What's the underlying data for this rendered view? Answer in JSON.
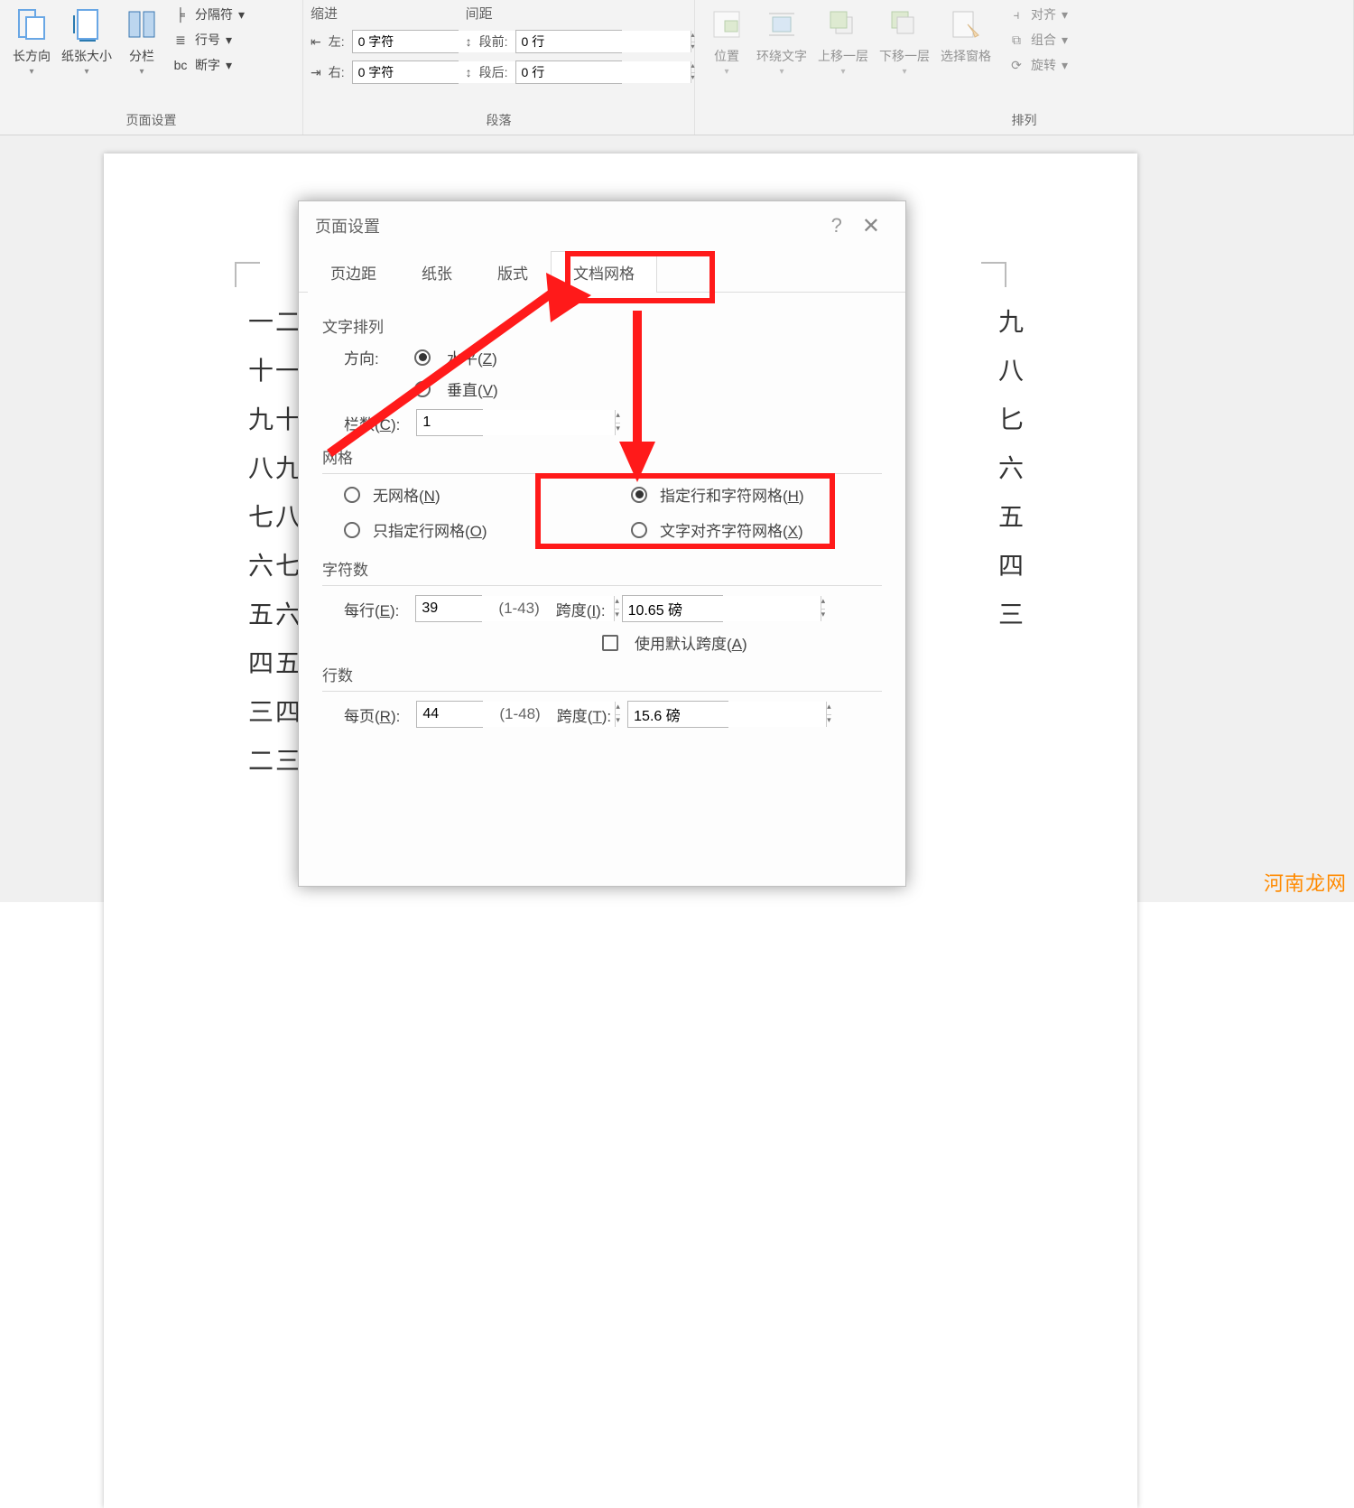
{
  "ribbon": {
    "pageSetup": {
      "label": "页面设置",
      "orientation": "长方向",
      "size": "纸张大小",
      "columns": "分栏",
      "breaks": "分隔符",
      "lineNumbers": "行号",
      "hyphenation": "断字"
    },
    "paragraph": {
      "label": "段落",
      "indentLabel": "缩进",
      "spacingLabel": "间距",
      "leftLabel": "左:",
      "rightLabel": "右:",
      "beforeLabel": "段前:",
      "afterLabel": "段后:",
      "leftVal": "0 字符",
      "rightVal": "0 字符",
      "beforeVal": "0 行",
      "afterVal": "0 行"
    },
    "arrange": {
      "label": "排列",
      "position": "位置",
      "wrap": "环绕文字",
      "forward": "上移一层",
      "backward": "下移一层",
      "selection": "选择窗格",
      "align": "对齐",
      "group": "组合",
      "rotate": "旋转"
    }
  },
  "doc": {
    "leftLines": [
      "一二",
      "十一",
      "九十",
      "八九",
      "七八",
      "六七",
      "五六",
      "四五",
      "三四",
      "二三"
    ],
    "rightLines": [
      "九",
      "八",
      "匕",
      "六",
      "五",
      "四",
      "三"
    ]
  },
  "dialog": {
    "title": "页面设置",
    "tabs": {
      "margins": "页边距",
      "paper": "纸张",
      "layout": "版式",
      "grid": "文档网格"
    },
    "textDirection": {
      "title": "文字排列",
      "dirLabel": "方向:",
      "horiz": "水平(Z)",
      "vert": "垂直(V)",
      "colsLabel": "栏数(C):",
      "colsVal": "1"
    },
    "grid": {
      "title": "网格",
      "none": "无网格(N)",
      "both": "指定行和字符网格(H)",
      "linesOnly": "只指定行网格(O)",
      "snap": "文字对齐字符网格(X)"
    },
    "chars": {
      "title": "字符数",
      "perLine": "每行(E):",
      "perLineVal": "39",
      "perLineRange": "(1-43)",
      "pitch": "跨度(I):",
      "pitchVal": "10.65 磅",
      "default": "使用默认跨度(A)"
    },
    "lines": {
      "title": "行数",
      "perPage": "每页(R):",
      "perPageVal": "44",
      "perPageRange": "(1-48)",
      "pitch": "跨度(T):",
      "pitchVal": "15.6 磅"
    }
  },
  "watermark": "河南龙网"
}
